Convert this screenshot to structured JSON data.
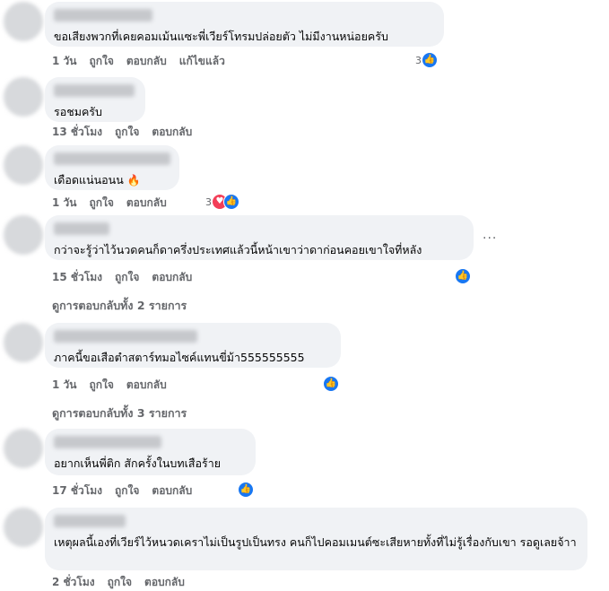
{
  "comments": [
    {
      "text": "ขอเสียงพวกที่เคยคอมเม้นแซะพี่เวียร์โทรมปล่อยตัว ไม่มีงานหน่อยครับ",
      "time": "1 วัน",
      "like": "ถูกใจ",
      "reply": "ตอบกลับ",
      "edited": "แก้ไขแล้ว",
      "reaction_count": "3"
    },
    {
      "text": "รอชมครับ",
      "time": "13 ชั่วโมง",
      "like": "ถูกใจ",
      "reply": "ตอบกลับ"
    },
    {
      "text": "เดือดแน่นอนน",
      "emoji": "🔥",
      "time": "1 วัน",
      "like": "ถูกใจ",
      "reply": "ตอบกลับ",
      "reaction_count": "3"
    },
    {
      "text": "กว่าจะรู้ว่าไว้นวดคนก็ดาครึ่งประเทศแล้วนี้หน้าเขาว่าดาก่อนคอยเขาใจที่หลัง",
      "time": "15 ชั่วโมง",
      "like": "ถูกใจ",
      "reply": "ตอบกลับ"
    },
    {
      "text": "ภาคนี้ขอเสือตำสตาร์ทมอไซค์แทนขี่ม้า555555555",
      "time": "1 วัน",
      "like": "ถูกใจ",
      "reply": "ตอบกลับ"
    },
    {
      "text": "อยากเห็นพี่ติก สักครั้งในบทเสือร้าย",
      "time": "17 ชั่วโมง",
      "like": "ถูกใจ",
      "reply": "ตอบกลับ"
    },
    {
      "text": "เหตุผลนี้เองที่เวียร์ไว้หนวดเคราไม่เป็นรูปเป็นทรง คนก็ไปคอมเมนต์ซะเสียหายทั้งที่ไม่รู้เรื่องกับเขา รอดูเลยจ้าา",
      "time": "2 ชั่วโมง",
      "like": "ถูกใจ",
      "reply": "ตอบกลับ"
    }
  ],
  "view_replies": [
    "ดูการตอบกลับทั้ง 2 รายการ",
    "ดูการตอบกลับทั้ง 3 รายการ"
  ],
  "more_label": "···",
  "icons": {
    "like": "like-icon",
    "heart": "heart-icon",
    "more": "more-options-icon"
  }
}
